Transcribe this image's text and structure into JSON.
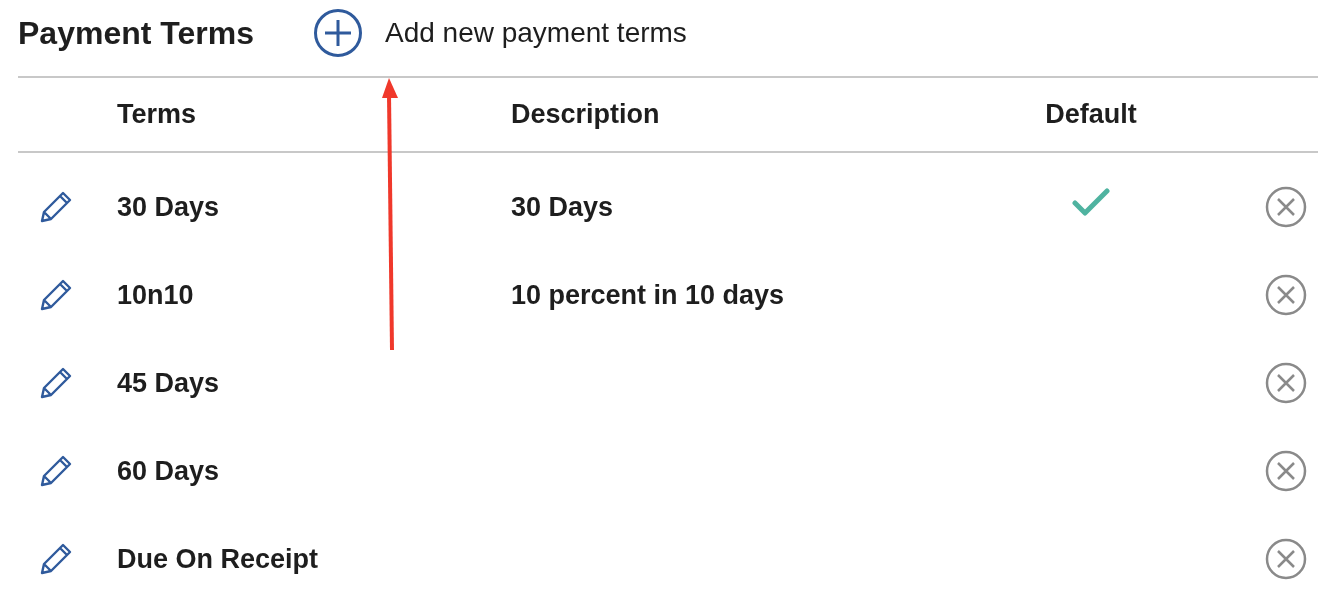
{
  "header": {
    "title": "Payment Terms",
    "add_link": "Add new payment terms"
  },
  "table": {
    "columns": [
      "Terms",
      "Description",
      "Default"
    ],
    "rows": [
      {
        "terms": "30 Days",
        "description": "30 Days",
        "default": true
      },
      {
        "terms": "10n10",
        "description": "10 percent in 10 days",
        "default": false
      },
      {
        "terms": "45 Days",
        "default": false
      },
      {
        "terms": "60 Days",
        "default": false
      },
      {
        "terms": "Due On Receipt",
        "default": false
      }
    ]
  },
  "annotations": [
    {
      "kind": "arrow"
    }
  ]
}
